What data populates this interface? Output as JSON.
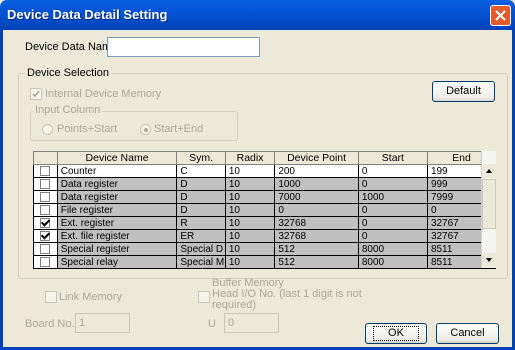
{
  "window": {
    "title": "Device Data Detail Setting"
  },
  "device_data_name": {
    "label": "Device Data Name",
    "value": ""
  },
  "device_selection": {
    "title": "Device Selection",
    "internal_memory_label": "Internal Device Memory",
    "default_button": "Default",
    "input_column": {
      "title": "Input Column",
      "option_points_start": "Points+Start",
      "option_start_end": "Start+End",
      "selected": "Start+End"
    }
  },
  "table": {
    "headers": [
      "",
      "Device Name",
      "Sym.",
      "Radix",
      "Device Point",
      "Start",
      "End"
    ],
    "rows": [
      {
        "checked": false,
        "name": "Counter",
        "sym": "C",
        "radix": "10",
        "point": "200",
        "start": "0",
        "end": "199"
      },
      {
        "checked": false,
        "name": "Data register",
        "sym": "D",
        "radix": "10",
        "point": "1000",
        "start": "0",
        "end": "999"
      },
      {
        "checked": false,
        "name": "Data register",
        "sym": "D",
        "radix": "10",
        "point": "7000",
        "start": "1000",
        "end": "7999"
      },
      {
        "checked": false,
        "name": "File register",
        "sym": "D",
        "radix": "10",
        "point": "0",
        "start": "0",
        "end": "0"
      },
      {
        "checked": true,
        "name": "Ext. register",
        "sym": "R",
        "radix": "10",
        "point": "32768",
        "start": "0",
        "end": "32767"
      },
      {
        "checked": true,
        "name": "Ext. file register",
        "sym": "ER",
        "radix": "10",
        "point": "32768",
        "start": "0",
        "end": "32767"
      },
      {
        "checked": false,
        "name": "Special register",
        "sym": "Special D",
        "radix": "10",
        "point": "512",
        "start": "8000",
        "end": "8511"
      },
      {
        "checked": false,
        "name": "Special relay",
        "sym": "Special M",
        "radix": "10",
        "point": "512",
        "start": "8000",
        "end": "8511"
      }
    ]
  },
  "link_memory_label": "Link Memory",
  "buffer_memory_label": "Buffer Memory\nHead I/O No. (last 1 digit is not\nrequired)",
  "board_no": {
    "label": "Board No.",
    "value": "1"
  },
  "u_field": {
    "label": "U",
    "value": "0"
  },
  "ok_button": "OK",
  "cancel_button": "Cancel"
}
